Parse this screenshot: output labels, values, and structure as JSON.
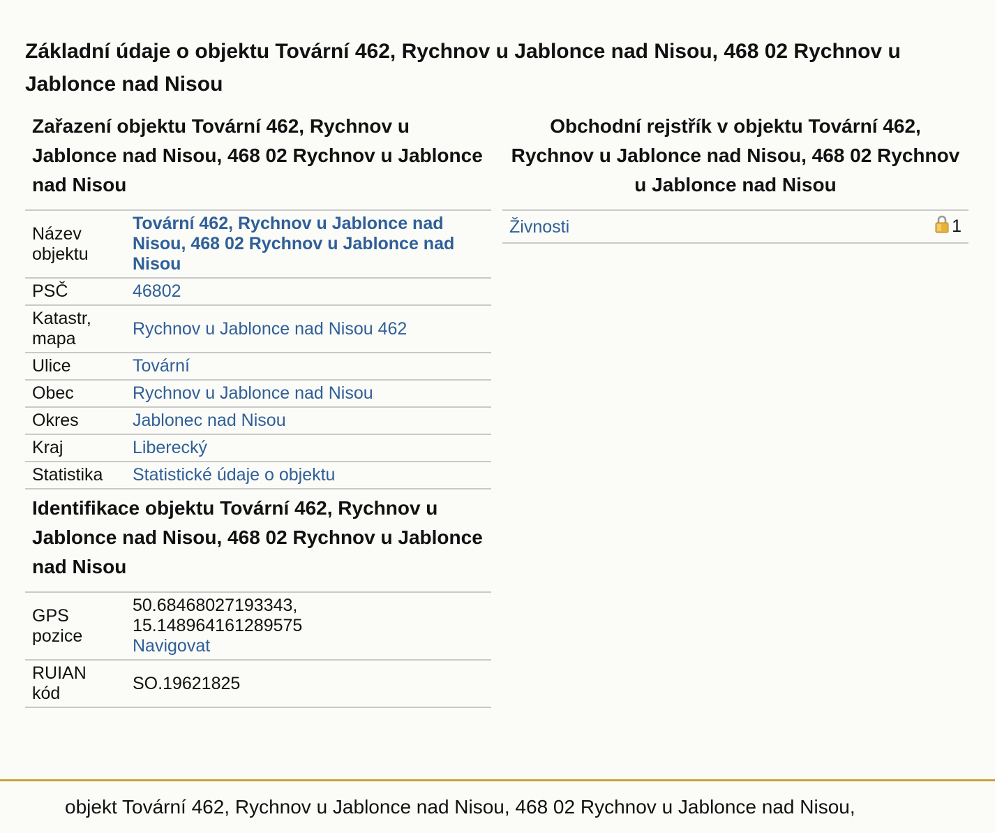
{
  "page_title": "Základní údaje o objektu Tovární 462, Rychnov u Jablonce nad Nisou, 468 02 Rychnov u Jablonce nad Nisou",
  "classification": {
    "title": "Zařazení objektu Tovární 462, Rychnov u Jablonce nad Nisou, 468 02 Rychnov u Jablonce nad Nisou",
    "rows": [
      {
        "key": "Název objektu",
        "value": "Tovární 462, Rychnov u Jablonce nad Nisou, 468 02 Rychnov u Jablonce nad Nisou"
      },
      {
        "key": "PSČ",
        "value": "46802"
      },
      {
        "key": "Katastr, mapa",
        "value": "Rychnov u Jablonce nad Nisou 462"
      },
      {
        "key": "Ulice",
        "value": "Tovární"
      },
      {
        "key": "Obec",
        "value": "Rychnov u Jablonce nad Nisou"
      },
      {
        "key": "Okres",
        "value": "Jablonec nad Nisou"
      },
      {
        "key": "Kraj",
        "value": "Liberecký"
      },
      {
        "key": "Statistika",
        "value": "Statistické údaje o objektu"
      }
    ]
  },
  "identification": {
    "title": "Identifikace objektu Tovární 462, Rychnov u Jablonce nad Nisou, 468 02 Rychnov u Jablonce nad Nisou",
    "gps": {
      "key": "GPS pozice",
      "lat": "50.68468027193343,",
      "lon": "15.148964161289575",
      "navigate_label": "Navigovat"
    },
    "ruian": {
      "key": "RUIAN kód",
      "value": "SO.19621825"
    }
  },
  "register": {
    "title": "Obchodní rejstřík v objektu Tovární 462, Rychnov u Jablonce nad Nisou, 468 02 Rychnov u Jablonce nad Nisou",
    "item_label": "Živnosti",
    "item_icon": "lock-icon",
    "item_count": "1"
  },
  "footer": {
    "text": "objekt Tovární 462, Rychnov u Jablonce nad Nisou, 468 02 Rychnov u Jablonce nad Nisou,",
    "accent_color": "#c9a33a"
  },
  "colors": {
    "link": "#2f5f98",
    "background": "#fbfbf8",
    "divider": "#c9c9c9"
  }
}
